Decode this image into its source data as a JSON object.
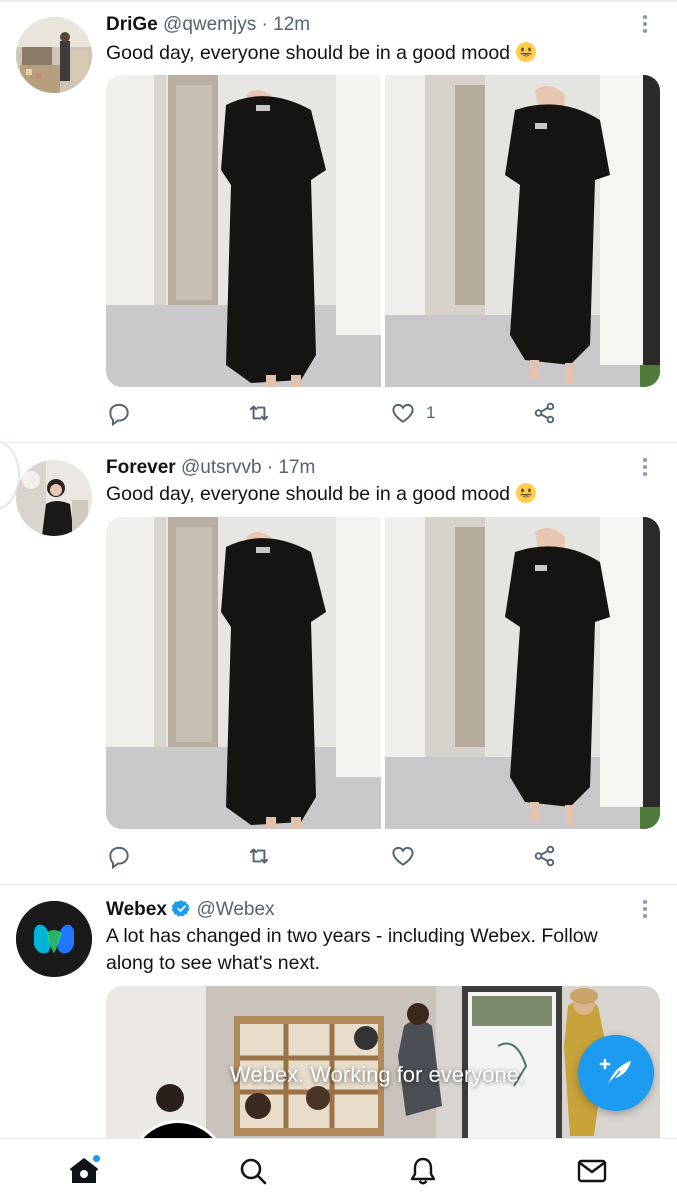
{
  "tweets": [
    {
      "name": "DriGe",
      "handle": "@qwemjys",
      "time": "· 12m",
      "text": "Good day, everyone should be in a good mood",
      "emoji": "grinning-face",
      "likes": "1"
    },
    {
      "name": "Forever",
      "handle": "@utsrvvb",
      "time": "· 17m",
      "text": "Good day, everyone should be in a good mood",
      "emoji": "grinning-face",
      "likes": ""
    },
    {
      "name": "Webex",
      "handle": "@Webex",
      "verified": true,
      "text": "A lot has changed in two years - including Webex. Follow along to see what's next.",
      "media_caption": "Webex. Working for everyone."
    }
  ],
  "icons": {
    "reply": "reply-icon",
    "retweet": "retweet-icon",
    "like": "heart-icon",
    "share": "share-icon",
    "more": "more-options-icon",
    "compose": "compose-tweet-icon"
  },
  "bottom_nav": [
    "home-icon",
    "search-icon",
    "notifications-icon",
    "messages-icon"
  ],
  "colors": {
    "accent": "#1d9bf0",
    "secondary_text": "#536471",
    "divider": "#e6ecf0",
    "webex_avatar_bg": "#1a1a1a"
  }
}
